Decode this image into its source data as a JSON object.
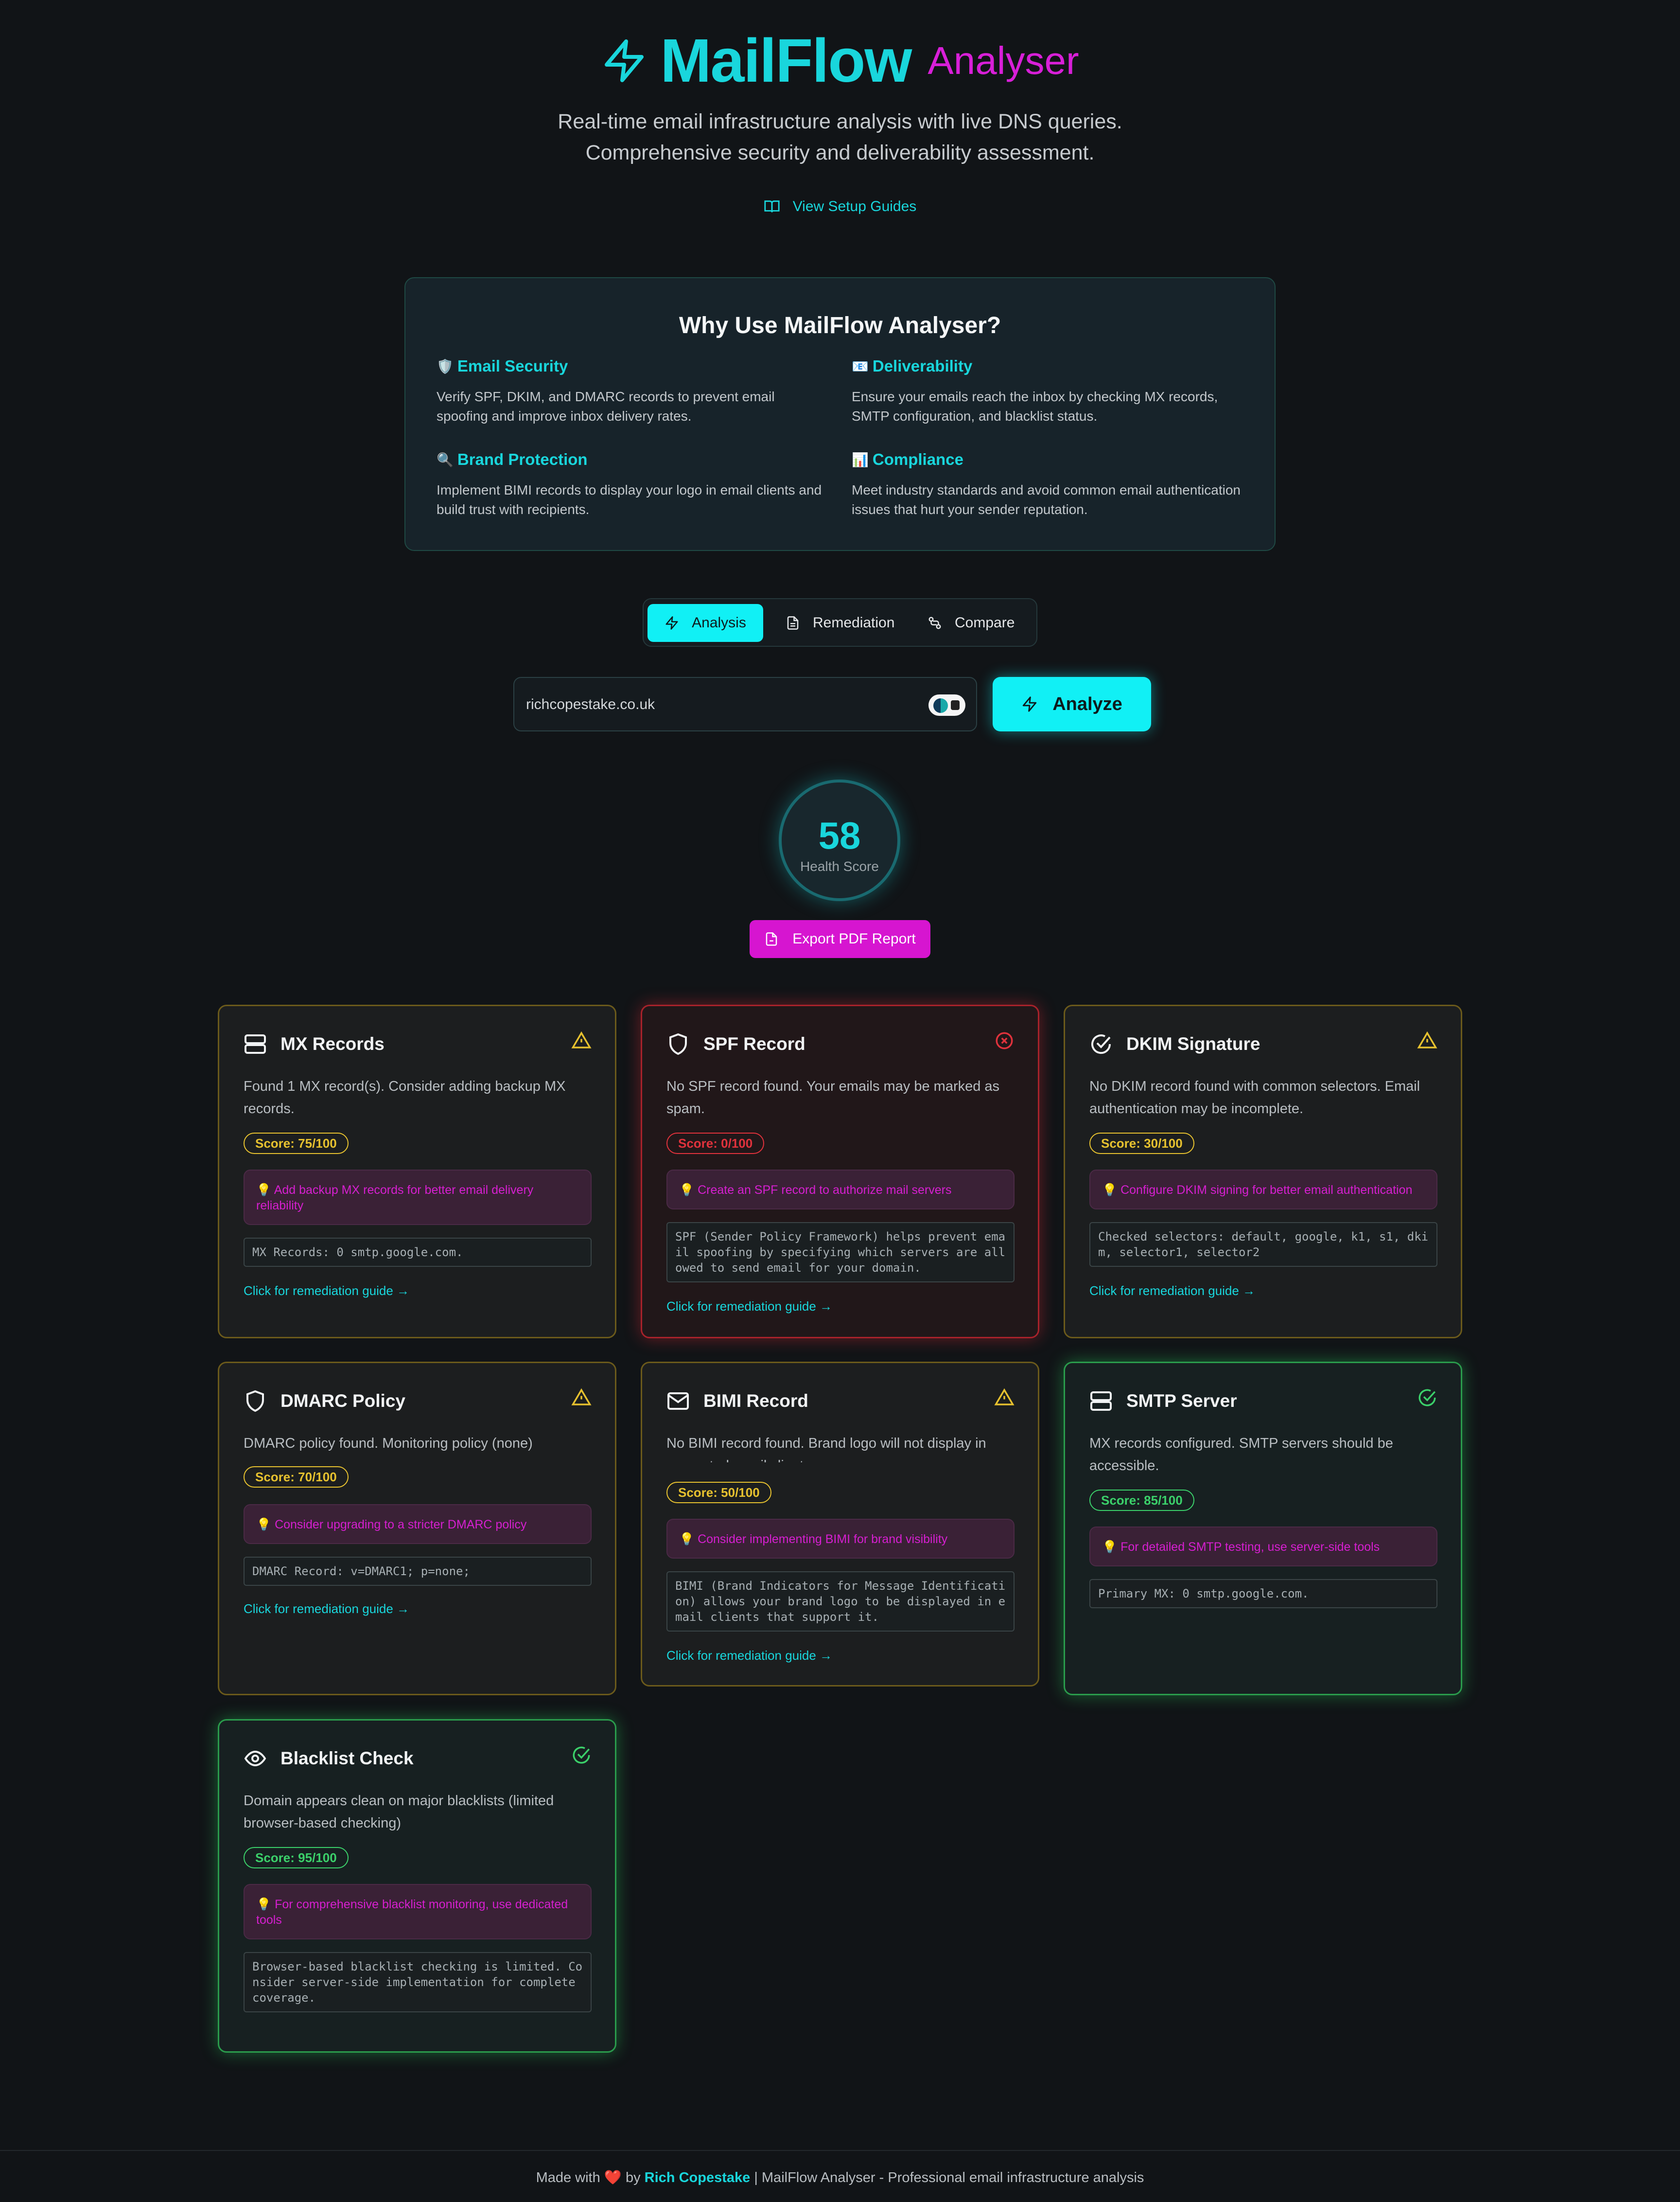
{
  "header": {
    "title": "MailFlow",
    "subtitle": "Analyser",
    "tagline": "Real-time email infrastructure analysis with live DNS queries. Comprehensive security and deliverability assessment.",
    "guides_link": "View Setup Guides"
  },
  "why": {
    "heading": "Why Use MailFlow Analyser?",
    "features": [
      {
        "icon": "🛡️",
        "title": "Email Security",
        "desc": "Verify SPF, DKIM, and DMARC records to prevent email spoofing and improve inbox delivery rates."
      },
      {
        "icon": "📧",
        "title": "Deliverability",
        "desc": "Ensure your emails reach the inbox by checking MX records, SMTP configuration, and blacklist status."
      },
      {
        "icon": "🔍",
        "title": "Brand Protection",
        "desc": "Implement BIMI records to display your logo in email clients and build trust with recipients."
      },
      {
        "icon": "📊",
        "title": "Compliance",
        "desc": "Meet industry standards and avoid common email authentication issues that hurt your sender reputation."
      }
    ]
  },
  "tabs": [
    {
      "label": "Analysis",
      "icon": "bolt-icon",
      "active": true
    },
    {
      "label": "Remediation",
      "icon": "document-icon",
      "active": false
    },
    {
      "label": "Compare",
      "icon": "compare-icon",
      "active": false
    }
  ],
  "search": {
    "value": "richcopestake.co.uk",
    "analyze_label": "Analyze"
  },
  "health": {
    "score": "58",
    "label": "Health Score"
  },
  "export_label": "Export PDF Report",
  "cards": [
    {
      "title": "MX Records",
      "icon": "server-icon",
      "status": "warning",
      "desc": "Found 1 MX record(s). Consider adding backup MX records.",
      "score": "Score: 75/100",
      "tip": "💡 Add backup MX records for better email delivery reliability",
      "code": "MX Records: 0 smtp.google.com.",
      "link": "Click for remediation guide →"
    },
    {
      "title": "SPF Record",
      "icon": "shield-icon",
      "status": "error",
      "desc": "No SPF record found. Your emails may be marked as spam.",
      "score": "Score: 0/100",
      "tip": "💡 Create an SPF record to authorize mail servers",
      "code": "SPF (Sender Policy Framework) helps prevent email spoofing by specifying which servers are allowed to send email for your domain.",
      "link": "Click for remediation guide →"
    },
    {
      "title": "DKIM Signature",
      "icon": "check-circle-icon",
      "status": "warning",
      "desc": "No DKIM record found with common selectors. Email authentication may be incomplete.",
      "score": "Score: 30/100",
      "tip": "💡 Configure DKIM signing for better email authentication",
      "code": "Checked selectors: default, google, k1, s1, dkim, selector1, selector2",
      "link": "Click for remediation guide →"
    },
    {
      "title": "DMARC Policy",
      "icon": "shield-icon",
      "status": "warning",
      "desc": "DMARC policy found. Monitoring policy (none)",
      "score": "Score: 70/100",
      "tip": "💡 Consider upgrading to a stricter DMARC policy",
      "code": "DMARC Record: v=DMARC1; p=none;",
      "link": "Click for remediation guide →"
    },
    {
      "title": "BIMI Record",
      "icon": "mail-icon",
      "status": "warning",
      "desc": "No BIMI record found. Brand logo will not display in supported email clients",
      "score": "Score: 50/100",
      "tip": "💡 Consider implementing BIMI for brand visibility",
      "code": "BIMI (Brand Indicators for Message Identification) allows your brand logo to be displayed in email clients that support it.",
      "link": "Click for remediation guide →"
    },
    {
      "title": "SMTP Server",
      "icon": "server-icon",
      "status": "ok",
      "desc": "MX records configured. SMTP servers should be accessible.",
      "score": "Score: 85/100",
      "tip": "💡 For detailed SMTP testing, use server-side tools",
      "code": "Primary MX: 0 smtp.google.com.",
      "link": ""
    },
    {
      "title": "Blacklist Check",
      "icon": "eye-icon",
      "status": "ok",
      "desc": "Domain appears clean on major blacklists (limited browser-based checking)",
      "score": "Score: 95/100",
      "tip": "💡 For comprehensive blacklist monitoring, use dedicated tools",
      "code": "Browser-based blacklist checking is limited. Consider server-side implementation for complete coverage.",
      "link": ""
    }
  ],
  "footer": {
    "made_with": "Made with",
    "heart": "❤️",
    "by": "by",
    "author": "Rich Copestake",
    "rest": "| MailFlow Analyser - Professional email infrastructure analysis"
  },
  "colors": {
    "accent": "#19d6dc",
    "magenta": "#d615d0",
    "warning": "#e6c12f",
    "error": "#e0323c",
    "success": "#3bd06a",
    "background": "#111417"
  }
}
